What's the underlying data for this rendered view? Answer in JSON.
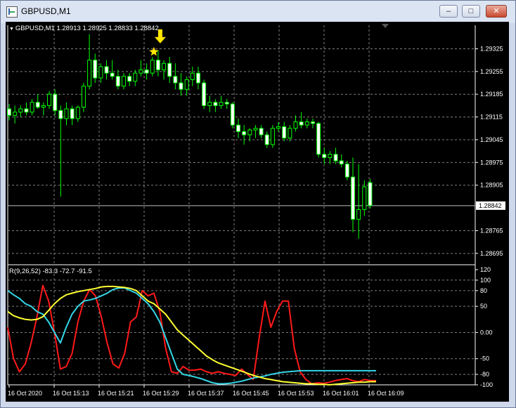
{
  "window": {
    "title": "GBPUSD,M1",
    "buttons": {
      "minimize": "–",
      "maximize": "□",
      "close": "✕"
    }
  },
  "main_chart": {
    "label": "GBPUSD,M1  1.28913 1.28925 1.28833 1.28842",
    "current_price": "1.28842",
    "price_ticks": [
      "1.29325",
      "1.29255",
      "1.29185",
      "1.29115",
      "1.29045",
      "1.28975",
      "1.28905",
      "1.28765",
      "1.28695"
    ],
    "price_range": [
      1.2866,
      1.2938
    ]
  },
  "indicator": {
    "label": "R(9,26,52) -83.3 -72.7 -91.5",
    "ticks": [
      "120",
      "100",
      "80",
      "50",
      "0.00",
      "-50",
      "-80",
      "-100"
    ]
  },
  "time_axis": [
    "16 Oct 2020",
    "16 Oct 15:13",
    "16 Oct 15:21",
    "16 Oct 15:29",
    "16 Oct 15:37",
    "16 Oct 15:45",
    "16 Oct 15:53",
    "16 Oct 16:01",
    "16 Oct 16:09"
  ],
  "colors": {
    "bull": "#00ff00",
    "bear": "#ffffff",
    "grid": "#808080",
    "red": "#ff1a1a",
    "cyan": "#33d6e6",
    "yellow": "#ffff33",
    "arrow": "#ffe600"
  },
  "chart_data": {
    "type": "candlestick",
    "candles": [
      [
        1.2914,
        1.29155,
        1.29105,
        1.2912
      ],
      [
        1.2912,
        1.2915,
        1.29095,
        1.2913
      ],
      [
        1.2913,
        1.2915,
        1.29115,
        1.2914
      ],
      [
        1.2914,
        1.2916,
        1.2912,
        1.2913
      ],
      [
        1.2913,
        1.2917,
        1.2912,
        1.2916
      ],
      [
        1.2916,
        1.29185,
        1.2914,
        1.29145
      ],
      [
        1.29145,
        1.2916,
        1.2912,
        1.2915
      ],
      [
        1.2915,
        1.29195,
        1.2914,
        1.29185
      ],
      [
        1.29185,
        1.292,
        1.2912,
        1.29135
      ],
      [
        1.29135,
        1.2915,
        1.2887,
        1.2911
      ],
      [
        1.2911,
        1.2916,
        1.2909,
        1.2914
      ],
      [
        1.2914,
        1.2915,
        1.2909,
        1.2911
      ],
      [
        1.2911,
        1.2915,
        1.291,
        1.29145
      ],
      [
        1.29145,
        1.2922,
        1.2913,
        1.2921
      ],
      [
        1.2921,
        1.2937,
        1.292,
        1.2929
      ],
      [
        1.2929,
        1.2931,
        1.2922,
        1.29235
      ],
      [
        1.29235,
        1.2928,
        1.2922,
        1.2927
      ],
      [
        1.2927,
        1.2929,
        1.2923,
        1.2925
      ],
      [
        1.2925,
        1.2929,
        1.2923,
        1.2924
      ],
      [
        1.2924,
        1.2926,
        1.292,
        1.2921
      ],
      [
        1.2921,
        1.2925,
        1.292,
        1.2924
      ],
      [
        1.2924,
        1.2925,
        1.2921,
        1.29225
      ],
      [
        1.29225,
        1.2926,
        1.2921,
        1.2925
      ],
      [
        1.2925,
        1.2929,
        1.2924,
        1.2926
      ],
      [
        1.2926,
        1.2928,
        1.2923,
        1.2925
      ],
      [
        1.2925,
        1.293,
        1.2924,
        1.2929
      ],
      [
        1.2929,
        1.2932,
        1.2924,
        1.2926
      ],
      [
        1.2926,
        1.2929,
        1.2923,
        1.2928
      ],
      [
        1.2928,
        1.293,
        1.2922,
        1.2924
      ],
      [
        1.2924,
        1.2928,
        1.292,
        1.2922
      ],
      [
        1.2922,
        1.2925,
        1.2918,
        1.292
      ],
      [
        1.292,
        1.2924,
        1.2918,
        1.2923
      ],
      [
        1.2923,
        1.2927,
        1.2921,
        1.2925
      ],
      [
        1.2925,
        1.2927,
        1.292,
        1.2922
      ],
      [
        1.2922,
        1.2923,
        1.2914,
        1.2915
      ],
      [
        1.2915,
        1.2918,
        1.2913,
        1.2916
      ],
      [
        1.2916,
        1.2917,
        1.2913,
        1.2915
      ],
      [
        1.2915,
        1.2918,
        1.2914,
        1.2916
      ],
      [
        1.2916,
        1.2917,
        1.2914,
        1.29155
      ],
      [
        1.29155,
        1.2916,
        1.2908,
        1.2909
      ],
      [
        1.2909,
        1.2911,
        1.2905,
        1.2907
      ],
      [
        1.2907,
        1.2909,
        1.2903,
        1.2906
      ],
      [
        1.2906,
        1.2908,
        1.2904,
        1.29075
      ],
      [
        1.29075,
        1.2909,
        1.2905,
        1.2908
      ],
      [
        1.2908,
        1.2909,
        1.2905,
        1.2906
      ],
      [
        1.2906,
        1.2907,
        1.2902,
        1.2903
      ],
      [
        1.2903,
        1.2909,
        1.2902,
        1.2908
      ],
      [
        1.2908,
        1.291,
        1.2907,
        1.29085
      ],
      [
        1.29085,
        1.291,
        1.2904,
        1.2905
      ],
      [
        1.2905,
        1.2909,
        1.2904,
        1.2908
      ],
      [
        1.2908,
        1.2912,
        1.2907,
        1.291
      ],
      [
        1.291,
        1.2913,
        1.2908,
        1.2909
      ],
      [
        1.2909,
        1.2911,
        1.2908,
        1.291
      ],
      [
        1.291,
        1.2911,
        1.2908,
        1.29095
      ],
      [
        1.29095,
        1.291,
        1.2899,
        1.29
      ],
      [
        1.29,
        1.2902,
        1.2897,
        1.2899
      ],
      [
        1.2899,
        1.2901,
        1.2897,
        1.29
      ],
      [
        1.29,
        1.2902,
        1.2897,
        1.2898
      ],
      [
        1.2898,
        1.29,
        1.2896,
        1.2897
      ],
      [
        1.2897,
        1.2898,
        1.2892,
        1.2893
      ],
      [
        1.2893,
        1.2899,
        1.2876,
        1.288
      ],
      [
        1.288,
        1.2897,
        1.2874,
        1.2883
      ],
      [
        1.2883,
        1.2892,
        1.2881,
        1.289
      ],
      [
        1.28913,
        1.28925,
        1.28833,
        1.28842
      ]
    ],
    "oscillator": {
      "x_count": 64,
      "y_range": [
        -100,
        120
      ],
      "series": [
        {
          "color": "red",
          "values": [
            10,
            -50,
            -75,
            -60,
            -20,
            30,
            90,
            60,
            0,
            -70,
            -65,
            -40,
            20,
            60,
            82,
            70,
            30,
            -20,
            -60,
            -68,
            -40,
            20,
            30,
            80,
            70,
            75,
            40,
            -30,
            -75,
            -78,
            -65,
            -72,
            -72,
            -70,
            -75,
            -78,
            -75,
            -78,
            -80,
            -82,
            -70,
            -80,
            -90,
            -10,
            60,
            10,
            40,
            60,
            60,
            -30,
            -75,
            -90,
            -98,
            -96,
            -97,
            -95,
            -92,
            -90,
            -88,
            -92,
            -94,
            -90,
            -92,
            -92
          ]
        },
        {
          "color": "cyan",
          "values": [
            80,
            72,
            65,
            55,
            50,
            40,
            35,
            20,
            0,
            -20,
            10,
            35,
            50,
            60,
            62,
            65,
            70,
            75,
            82,
            85,
            85,
            80,
            75,
            65,
            55,
            40,
            20,
            -10,
            -40,
            -70,
            -80,
            -82,
            -85,
            -88,
            -92,
            -96,
            -98,
            -98,
            -97,
            -95,
            -93,
            -90,
            -87,
            -85,
            -83,
            -80,
            -78,
            -76,
            -75,
            -74,
            -73,
            -73,
            -73,
            -73,
            -73,
            -73,
            -73,
            -73,
            -73,
            -73,
            -73,
            -73,
            -73,
            -73
          ]
        },
        {
          "color": "yellow",
          "values": [
            40,
            32,
            28,
            25,
            24,
            25,
            30,
            42,
            55,
            65,
            72,
            75,
            78,
            80,
            82,
            84,
            87,
            88,
            88,
            87,
            86,
            84,
            80,
            70,
            60,
            55,
            45,
            35,
            20,
            5,
            -5,
            -15,
            -25,
            -35,
            -45,
            -52,
            -58,
            -62,
            -66,
            -70,
            -74,
            -78,
            -82,
            -85,
            -88,
            -90,
            -92,
            -94,
            -95,
            -96,
            -97,
            -98,
            -98,
            -99,
            -99,
            -100,
            -99,
            -98,
            -97,
            -96,
            -95,
            -95,
            -94,
            -94
          ]
        }
      ]
    }
  }
}
